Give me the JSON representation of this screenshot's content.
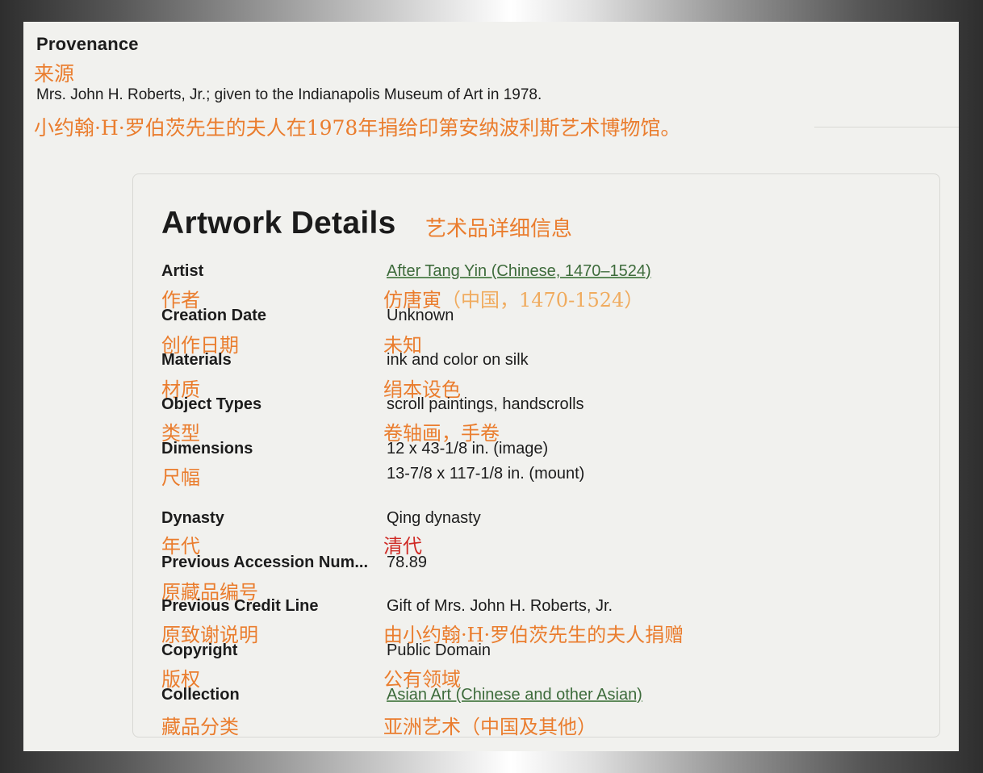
{
  "provenance": {
    "title": "Provenance",
    "title_zh": "来源",
    "text": "Mrs. John H. Roberts, Jr.; given to the Indianapolis Museum of Art in 1978.",
    "text_zh": "小约翰·H·罗伯茨先生的夫人在1978年捐给印第安纳波利斯艺术博物馆。"
  },
  "details": {
    "title": "Artwork Details",
    "title_zh": "艺术品详细信息",
    "artist": {
      "label": "Artist",
      "label_zh": "作者",
      "value": "After Tang Yin (Chinese, 1470–1524)",
      "value_zh_main": "仿唐寅",
      "value_zh_extra": "（中国，1470-1524）"
    },
    "creation_date": {
      "label": "Creation Date",
      "label_zh": "创作日期",
      "value": "Unknown",
      "value_zh": "未知"
    },
    "materials": {
      "label": "Materials",
      "label_zh": "材质",
      "value": "ink and color on silk",
      "value_zh": "绢本设色"
    },
    "object_types": {
      "label": "Object Types",
      "label_zh": "类型",
      "value": "scroll paintings, handscrolls",
      "value_zh": "卷轴画，手卷"
    },
    "dimensions": {
      "label": "Dimensions",
      "label_zh": "尺幅",
      "value_image": "12 x 43-1/8 in. (image)",
      "value_mount": "13-7/8 x 117-1/8 in. (mount)"
    },
    "dynasty": {
      "label": "Dynasty",
      "label_zh": "年代",
      "value": "Qing dynasty",
      "value_zh": "清代"
    },
    "previous_accession": {
      "label": "Previous Accession Num...",
      "label_zh": "原藏品编号",
      "value": "78.89"
    },
    "previous_credit": {
      "label": "Previous Credit Line",
      "label_zh": "原致谢说明",
      "value": "Gift of Mrs. John H. Roberts, Jr.",
      "value_zh": "由小约翰·H·罗伯茨先生的夫人捐赠"
    },
    "copyright": {
      "label": "Copyright",
      "label_zh": "版权",
      "value": "Public Domain",
      "value_zh": "公有领域"
    },
    "collection": {
      "label": "Collection",
      "label_zh": "藏品分类",
      "value": "Asian Art (Chinese and other Asian)",
      "value_zh": "亚洲艺术（中国及其他）"
    }
  },
  "colors": {
    "translation_orange": "#ea7d2e",
    "translation_red": "#cf2a25",
    "link_green": "#3d6b3b",
    "page_background": "#f1f1ee"
  }
}
